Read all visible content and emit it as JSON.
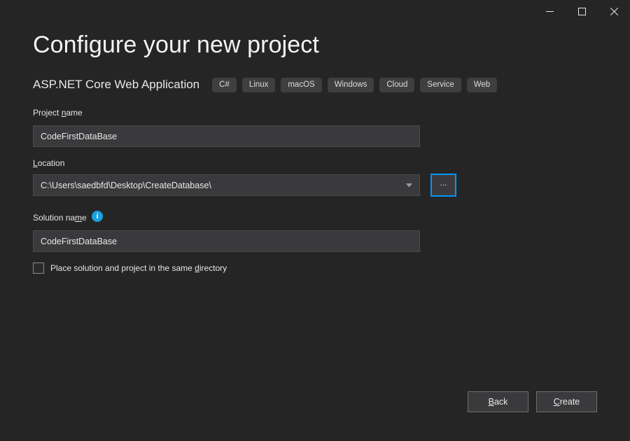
{
  "titlebar": {
    "minimize_label": "Minimize",
    "maximize_label": "Maximize",
    "close_label": "Close"
  },
  "header": {
    "title": "Configure your new project",
    "subtitle": "ASP.NET Core Web Application",
    "tags": [
      "C#",
      "Linux",
      "macOS",
      "Windows",
      "Cloud",
      "Service",
      "Web"
    ]
  },
  "form": {
    "project_name": {
      "label_before": "Project ",
      "label_accel": "n",
      "label_after": "ame",
      "value": "CodeFirstDataBase"
    },
    "location": {
      "label_accel": "L",
      "label_after": "ocation",
      "value": "C:\\Users\\saedbfd\\Desktop\\CreateDatabase\\",
      "browse_label": "...",
      "dropdown_icon": "chevron-down-icon"
    },
    "solution_name": {
      "label_before": "Solution na",
      "label_accel": "m",
      "label_after": "e",
      "value": "CodeFirstDataBase",
      "info_icon_glyph": "i"
    },
    "same_directory": {
      "checked": false,
      "label_before": "Place solution and project in the same ",
      "label_accel": "d",
      "label_after": "irectory"
    }
  },
  "footer": {
    "back": {
      "before": "",
      "accel": "B",
      "after": "ack"
    },
    "create": {
      "before": "",
      "accel": "C",
      "after": "reate"
    }
  },
  "colors": {
    "background": "#252526",
    "input_background": "#3a3a3c",
    "accent_focus": "#0097fb",
    "info_blue": "#1ba1e2",
    "tag_background": "#3f3f41"
  }
}
